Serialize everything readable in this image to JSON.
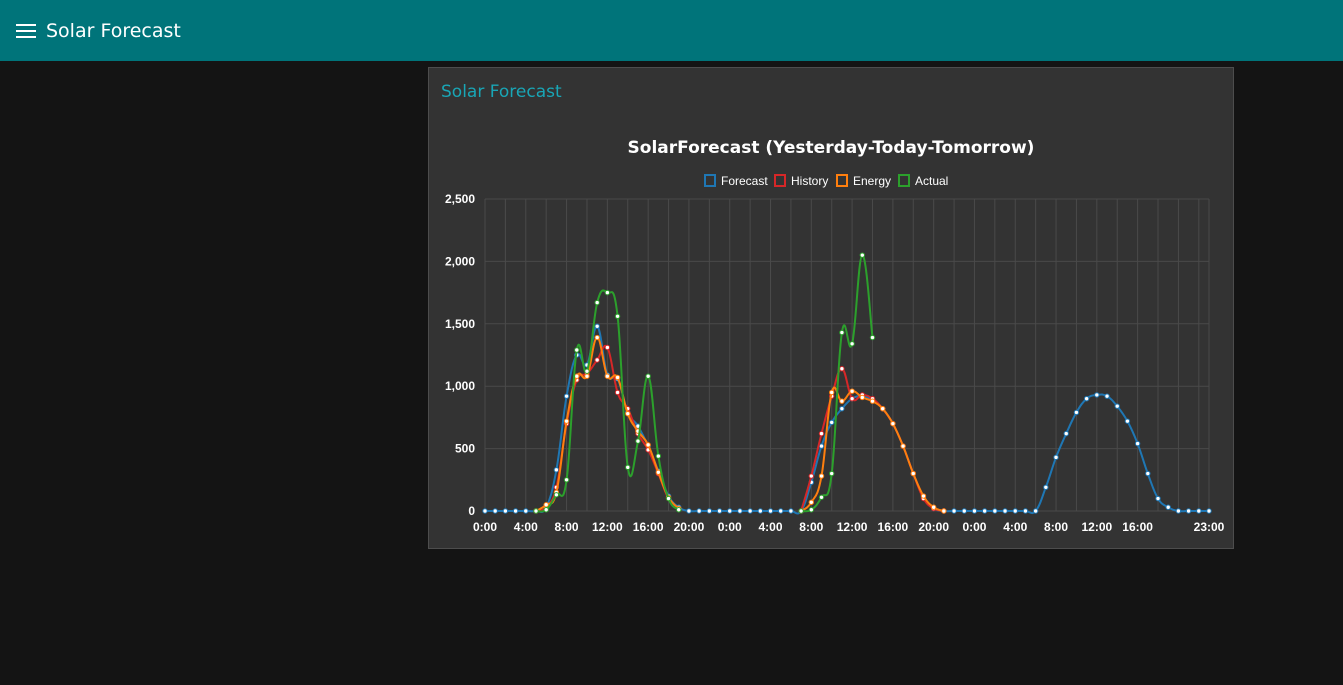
{
  "header": {
    "title": "Solar Forecast",
    "menu_icon": "hamburger-menu-icon"
  },
  "card": {
    "title": "Solar Forecast"
  },
  "colors": {
    "header_bg": "#00747a",
    "card_title": "#19a6b6",
    "forecast": "#1f77b4",
    "history": "#d62728",
    "energy": "#ff7f0e",
    "actual": "#2ca02c"
  },
  "chart_data": {
    "type": "line",
    "title": "SolarForecast (Yesterday-Today-Tomorrow)",
    "xlabel": "",
    "ylabel": "",
    "ylim": [
      0,
      2500
    ],
    "y_ticks": [
      0,
      500,
      1000,
      1500,
      2000,
      2500
    ],
    "y_tick_labels": [
      "0",
      "500",
      "1,000",
      "1,500",
      "2,000",
      "2,500"
    ],
    "grid": true,
    "legend_position": "top",
    "x_tick_labels": [
      "0:00",
      "4:00",
      "8:00",
      "12:00",
      "16:00",
      "20:00",
      "0:00",
      "4:00",
      "8:00",
      "12:00",
      "16:00",
      "20:00",
      "0:00",
      "4:00",
      "8:00",
      "12:00",
      "16:00",
      "23:00"
    ],
    "x_tick_hours": [
      0,
      4,
      8,
      12,
      16,
      20,
      24,
      28,
      32,
      36,
      40,
      44,
      48,
      52,
      56,
      60,
      64,
      71
    ],
    "x_range_hours": [
      0,
      71
    ],
    "series": [
      {
        "name": "Forecast",
        "color": "#1f77b4",
        "points": [
          [
            0,
            0
          ],
          [
            1,
            0
          ],
          [
            2,
            0
          ],
          [
            3,
            0
          ],
          [
            4,
            0
          ],
          [
            5,
            0
          ],
          [
            6,
            30
          ],
          [
            7,
            330
          ],
          [
            8,
            920
          ],
          [
            9,
            1250
          ],
          [
            10,
            1170
          ],
          [
            11,
            1480
          ],
          [
            12,
            1090
          ],
          [
            13,
            1060
          ],
          [
            14,
            790
          ],
          [
            15,
            680
          ],
          [
            16,
            520
          ],
          [
            17,
            320
          ],
          [
            18,
            120
          ],
          [
            19,
            30
          ],
          [
            20,
            0
          ],
          [
            21,
            0
          ],
          [
            22,
            0
          ],
          [
            23,
            0
          ],
          [
            24,
            0
          ],
          [
            25,
            0
          ],
          [
            26,
            0
          ],
          [
            27,
            0
          ],
          [
            28,
            0
          ],
          [
            29,
            0
          ],
          [
            30,
            0
          ],
          [
            31,
            0
          ],
          [
            32,
            230
          ],
          [
            33,
            520
          ],
          [
            34,
            710
          ],
          [
            35,
            820
          ],
          [
            36,
            900
          ],
          [
            37,
            920
          ],
          [
            38,
            890
          ],
          [
            39,
            820
          ],
          [
            40,
            700
          ],
          [
            41,
            520
          ],
          [
            42,
            300
          ],
          [
            43,
            110
          ],
          [
            44,
            20
          ],
          [
            45,
            0
          ],
          [
            46,
            0
          ],
          [
            47,
            0
          ],
          [
            48,
            0
          ],
          [
            49,
            0
          ],
          [
            50,
            0
          ],
          [
            51,
            0
          ],
          [
            52,
            0
          ],
          [
            53,
            0
          ],
          [
            54,
            0
          ],
          [
            55,
            190
          ],
          [
            56,
            430
          ],
          [
            57,
            620
          ],
          [
            58,
            790
          ],
          [
            59,
            900
          ],
          [
            60,
            930
          ],
          [
            61,
            920
          ],
          [
            62,
            840
          ],
          [
            63,
            720
          ],
          [
            64,
            540
          ],
          [
            65,
            300
          ],
          [
            66,
            100
          ],
          [
            67,
            30
          ],
          [
            68,
            0
          ],
          [
            69,
            0
          ],
          [
            70,
            0
          ],
          [
            71,
            0
          ]
        ]
      },
      {
        "name": "History",
        "color": "#d62728",
        "points": [
          [
            5,
            0
          ],
          [
            6,
            30
          ],
          [
            7,
            190
          ],
          [
            8,
            700
          ],
          [
            9,
            1050
          ],
          [
            10,
            1100
          ],
          [
            11,
            1210
          ],
          [
            12,
            1310
          ],
          [
            13,
            950
          ],
          [
            14,
            820
          ],
          [
            15,
            620
          ],
          [
            16,
            490
          ],
          [
            17,
            300
          ],
          [
            18,
            100
          ],
          [
            19,
            20
          ],
          [
            31,
            0
          ],
          [
            32,
            280
          ],
          [
            33,
            620
          ],
          [
            34,
            920
          ],
          [
            35,
            1140
          ],
          [
            36,
            900
          ],
          [
            37,
            930
          ],
          [
            38,
            900
          ],
          [
            39,
            820
          ],
          [
            40,
            700
          ],
          [
            41,
            520
          ],
          [
            42,
            300
          ],
          [
            43,
            100
          ],
          [
            44,
            20
          ],
          [
            45,
            0
          ]
        ]
      },
      {
        "name": "Energy",
        "color": "#ff7f0e",
        "points": [
          [
            5,
            0
          ],
          [
            6,
            50
          ],
          [
            7,
            150
          ],
          [
            8,
            720
          ],
          [
            9,
            1080
          ],
          [
            10,
            1080
          ],
          [
            11,
            1390
          ],
          [
            12,
            1080
          ],
          [
            13,
            1070
          ],
          [
            14,
            780
          ],
          [
            15,
            640
          ],
          [
            16,
            530
          ],
          [
            17,
            310
          ],
          [
            18,
            110
          ],
          [
            19,
            20
          ],
          [
            31,
            0
          ],
          [
            32,
            70
          ],
          [
            33,
            280
          ],
          [
            34,
            950
          ],
          [
            35,
            880
          ],
          [
            36,
            960
          ],
          [
            37,
            910
          ],
          [
            38,
            880
          ],
          [
            39,
            820
          ],
          [
            40,
            700
          ],
          [
            41,
            520
          ],
          [
            42,
            300
          ],
          [
            43,
            120
          ],
          [
            44,
            30
          ],
          [
            45,
            0
          ]
        ]
      },
      {
        "name": "Actual",
        "color": "#2ca02c",
        "points": [
          [
            5,
            0
          ],
          [
            6,
            10
          ],
          [
            7,
            130
          ],
          [
            8,
            250
          ],
          [
            9,
            1290
          ],
          [
            10,
            1120
          ],
          [
            11,
            1670
          ],
          [
            12,
            1750
          ],
          [
            13,
            1560
          ],
          [
            14,
            350
          ],
          [
            15,
            560
          ],
          [
            16,
            1080
          ],
          [
            17,
            440
          ],
          [
            18,
            100
          ],
          [
            19,
            10
          ],
          [
            31,
            0
          ],
          [
            32,
            10
          ],
          [
            33,
            110
          ],
          [
            34,
            300
          ],
          [
            35,
            1430
          ],
          [
            36,
            1340
          ],
          [
            37,
            2050
          ],
          [
            38,
            1390
          ]
        ]
      }
    ]
  }
}
